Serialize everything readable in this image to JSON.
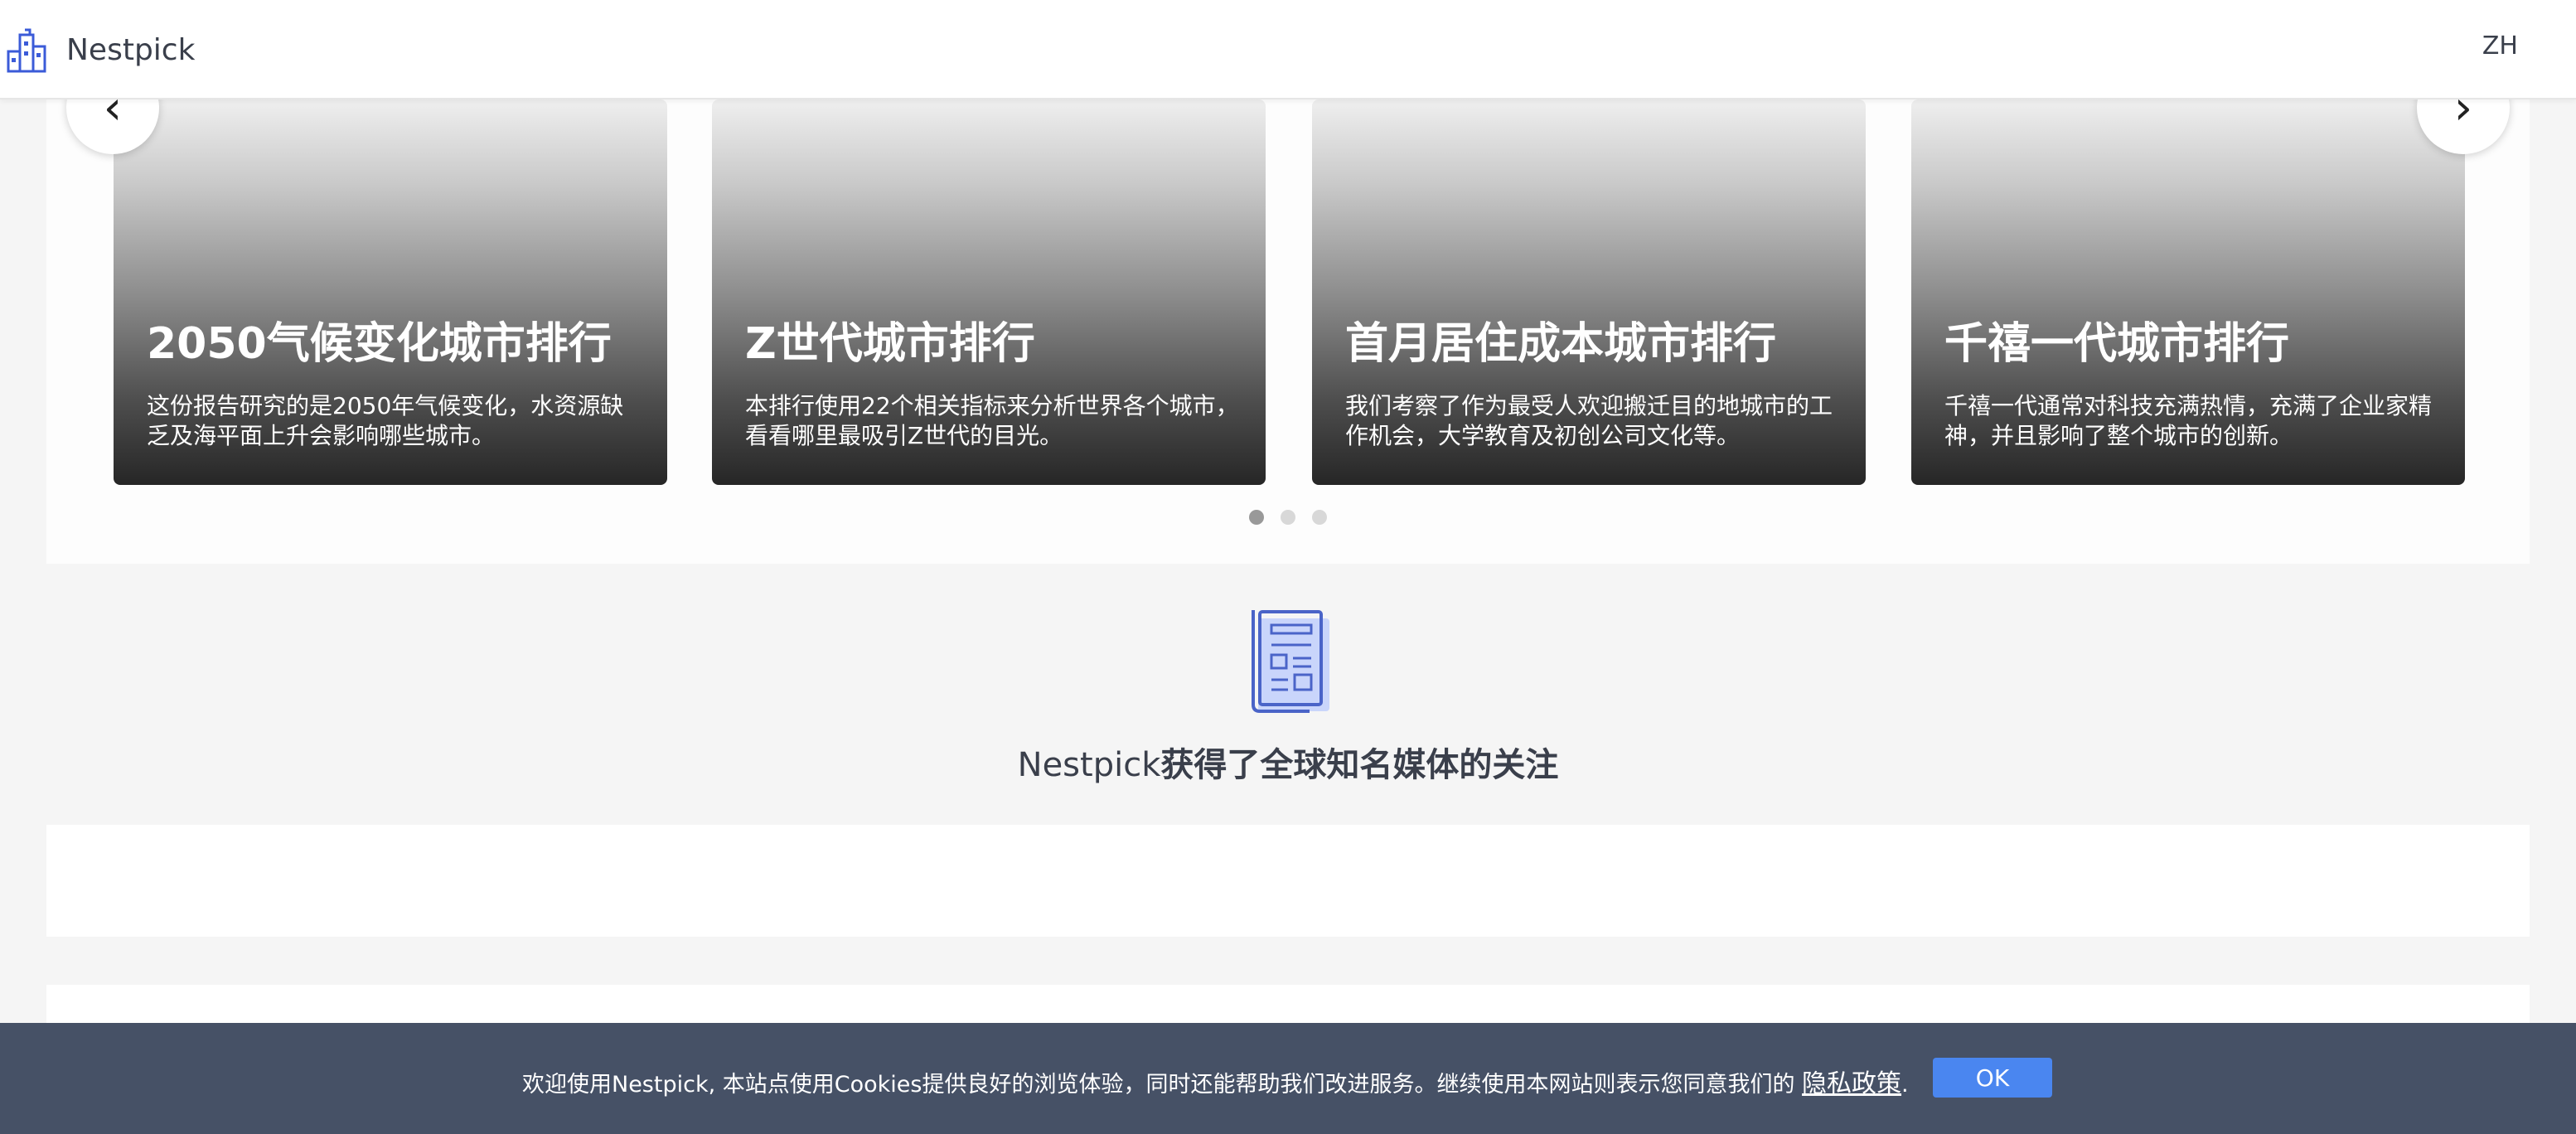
{
  "header": {
    "logo_text": "Nestpick",
    "language": "ZH"
  },
  "carousel": {
    "prev_arrow": "‹",
    "next_arrow": "›",
    "cards": [
      {
        "title": "2050气候变化城市排行",
        "description": "这份报告研究的是2050年气候变化，水资源缺乏及海平面上升会影响哪些城市。"
      },
      {
        "title": "Z世代城市排行",
        "description": "本排行使用22个相关指标来分析世界各个城市，看看哪里最吸引Z世代的目光。"
      },
      {
        "title": "首月居住成本城市排行",
        "description": "我们考察了作为最受人欢迎搬迁目的地城市的工作机会，大学教育及初创公司文化等。"
      },
      {
        "title": "千禧一代城市排行",
        "description": "千禧一代通常对科技充满热情，充满了企业家精神，并且影响了整个城市的创新。"
      }
    ],
    "active_dot": 0,
    "dot_count": 3
  },
  "media": {
    "icon": "newspaper-icon",
    "heading_prefix": "Nestpick",
    "heading_rest": "获得了全球知名媒体的关注"
  },
  "cookie": {
    "text": "欢迎使用Nestpick, 本站点使用Cookies提供良好的浏览体验，同时还能帮助我们改进服务。继续使用本网站则表示您同意我们的",
    "link_label": "隐私政策",
    "suffix": ".",
    "ok_label": "OK"
  },
  "colors": {
    "cookie_bar": "#465166",
    "ok_button": "#4a86f0",
    "header_bg": "#ffffff"
  }
}
